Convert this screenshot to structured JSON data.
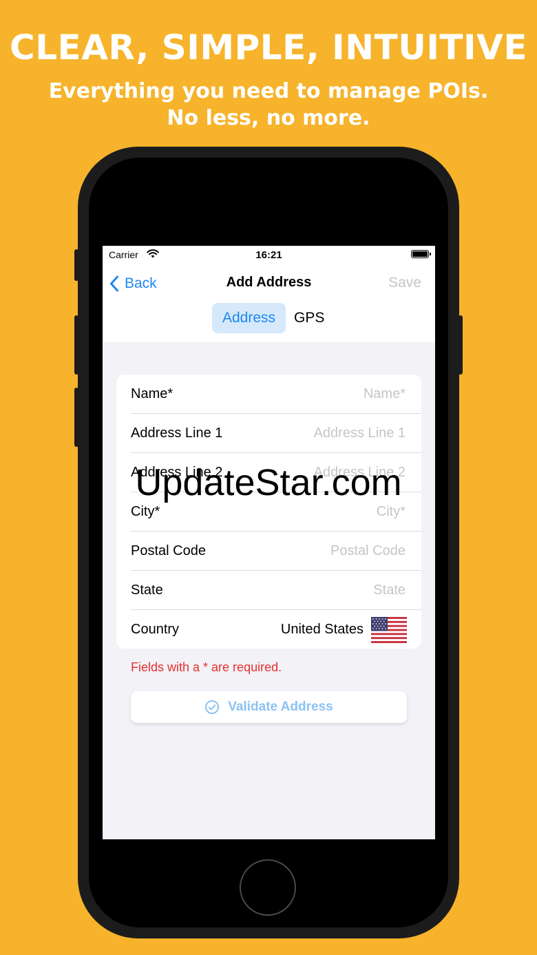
{
  "promo": {
    "headline": "CLEAR, SIMPLE, INTUITIVE",
    "subline_1": "Everything you need to manage POIs.",
    "subline_2": "No less, no more."
  },
  "status_bar": {
    "carrier": "Carrier",
    "time": "16:21"
  },
  "nav": {
    "back_label": "Back",
    "title": "Add Address",
    "save_label": "Save"
  },
  "segmented": {
    "tabs": [
      {
        "label": "Address",
        "selected": true
      },
      {
        "label": "GPS",
        "selected": false
      }
    ]
  },
  "form": {
    "rows": [
      {
        "label": "Name*",
        "placeholder": "Name*",
        "value": ""
      },
      {
        "label": "Address Line 1",
        "placeholder": "Address Line 1",
        "value": ""
      },
      {
        "label": "Address Line 2",
        "placeholder": "Address Line 2",
        "value": ""
      },
      {
        "label": "City*",
        "placeholder": "City*",
        "value": ""
      },
      {
        "label": "Postal Code",
        "placeholder": "Postal Code",
        "value": ""
      },
      {
        "label": "State",
        "placeholder": "State",
        "value": ""
      }
    ],
    "country": {
      "label": "Country",
      "value": "United States",
      "flag_icon": "us-flag-icon"
    }
  },
  "required_note": "Fields with a * are required.",
  "validate_button": {
    "label": "Validate Address",
    "icon": "checkmark-circle-icon"
  },
  "watermark": "UpdateStar.com",
  "colors": {
    "background": "#F6B32B",
    "accent": "#1E87F0",
    "accent_light": "#D5E9FB",
    "error": "#E5302F",
    "placeholder": "#C5C5C9"
  }
}
